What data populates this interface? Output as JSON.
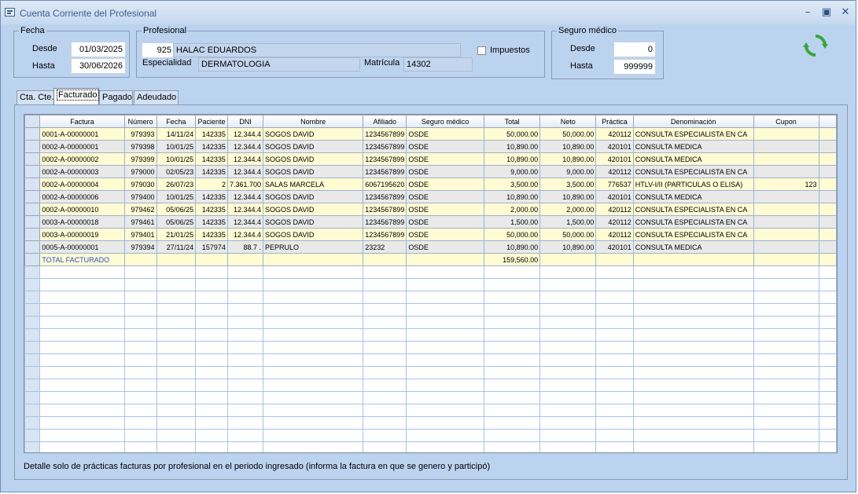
{
  "window": {
    "title": "Cuenta Corriente del Profesional",
    "icon": "app-window-icon"
  },
  "fecha": {
    "group_title": "Fecha",
    "desde_label": "Desde",
    "desde_value": "01/03/2025",
    "hasta_label": "Hasta",
    "hasta_value": "30/06/2026"
  },
  "profesional": {
    "group_title": "Profesional",
    "code": "925",
    "name": "HALAC EDUARDOS",
    "impuestos_label": "Impuestos",
    "impuestos_checked": false,
    "especialidad_label": "Especialidad",
    "especialidad_value": "DERMATOLOGIA",
    "matricula_label": "Matrícula",
    "matricula_value": "14302"
  },
  "seguro": {
    "group_title": "Seguro médico",
    "desde_label": "Desde",
    "desde_value": "0",
    "hasta_label": "Hasta",
    "hasta_value": "999999"
  },
  "tabs": [
    {
      "label": "Cta. Cte.",
      "active": false
    },
    {
      "label": "Facturado",
      "active": true
    },
    {
      "label": "Pagado",
      "active": false
    },
    {
      "label": "Adeudado",
      "active": false
    }
  ],
  "grid": {
    "columns": [
      "Factura",
      "Número",
      "Fecha",
      "Paciente",
      "DNI",
      "Nombre",
      "Afiliado",
      "Seguro médico",
      "Total",
      "Neto",
      "Práctica",
      "Denominación",
      "Cupon"
    ],
    "rows": [
      [
        "0001-A-00000001",
        "979393",
        "14/11/24",
        "142335",
        "12.344.4",
        "SOGOS DAVID",
        "1234567899",
        "OSDE",
        "50,000.00",
        "50,000.00",
        "420112",
        "CONSULTA ESPECIALISTA EN CA",
        ""
      ],
      [
        "0002-A-00000001",
        "979398",
        "10/01/25",
        "142335",
        "12.344.4",
        "SOGOS DAVID",
        "1234567899",
        "OSDE",
        "10,890.00",
        "10,890.00",
        "420101",
        "CONSULTA MEDICA",
        ""
      ],
      [
        "0002-A-00000002",
        "979399",
        "10/01/25",
        "142335",
        "12.344.4",
        "SOGOS DAVID",
        "1234567899",
        "OSDE",
        "10,890.00",
        "10,890.00",
        "420101",
        "CONSULTA MEDICA",
        ""
      ],
      [
        "0002-A-00000003",
        "979000",
        "02/05/23",
        "142335",
        "12.344.4",
        "SOGOS DAVID",
        "1234567899",
        "OSDE",
        "9,000.00",
        "9,000.00",
        "420112",
        "CONSULTA ESPECIALISTA EN CA",
        ""
      ],
      [
        "0002-A-00000004",
        "979030",
        "26/07/23",
        "2",
        "7.361.700",
        "SALAS MARCELA",
        "6067195620",
        "OSDE",
        "3,500.00",
        "3,500.00",
        "776537",
        "HTLV-I/II (PARTICULAS O ELISA)",
        "123"
      ],
      [
        "0002-A-00000006",
        "979400",
        "10/01/25",
        "142335",
        "12.344.4",
        "SOGOS DAVID",
        "1234567899",
        "OSDE",
        "10,890.00",
        "10,890.00",
        "420101",
        "CONSULTA MEDICA",
        ""
      ],
      [
        "0002-A-00000010",
        "979462",
        "05/06/25",
        "142335",
        "12.344.4",
        "SOGOS DAVID",
        "1234567899",
        "OSDE",
        "2,000.00",
        "2,000.00",
        "420112",
        "CONSULTA ESPECIALISTA EN CA",
        ""
      ],
      [
        "0003-A-00000018",
        "979461",
        "05/06/25",
        "142335",
        "12.344.4",
        "SOGOS DAVID",
        "1234567899",
        "OSDE",
        "1,500.00",
        "1,500.00",
        "420112",
        "CONSULTA ESPECIALISTA EN CA",
        ""
      ],
      [
        "0003-A-00000019",
        "979401",
        "21/01/25",
        "142335",
        "12.344.4",
        "SOGOS DAVID",
        "1234567899",
        "OSDE",
        "50,000.00",
        "50,000.00",
        "420112",
        "CONSULTA ESPECIALISTA EN CA",
        ""
      ],
      [
        "0005-A-00000001",
        "979394",
        "27/11/24",
        "157974",
        "88.7 .",
        "PEPRULO",
        "23232",
        "OSDE",
        "10,890.00",
        "10,890.00",
        "420101",
        "CONSULTA MEDICA",
        ""
      ]
    ],
    "total_label": "TOTAL FACTURADO",
    "total_value": "159,560.00"
  },
  "status_text": "Detalle solo de prácticas facturas por profesional en el periodo ingresado (informa la factura en que se genero y participó)",
  "colors": {
    "accent": "#3b5f8f",
    "row_odd": "#fffbd3",
    "row_even": "#e9e9e9",
    "window_bg": "#bcd3f0",
    "refresh_green": "#3aa63a"
  }
}
